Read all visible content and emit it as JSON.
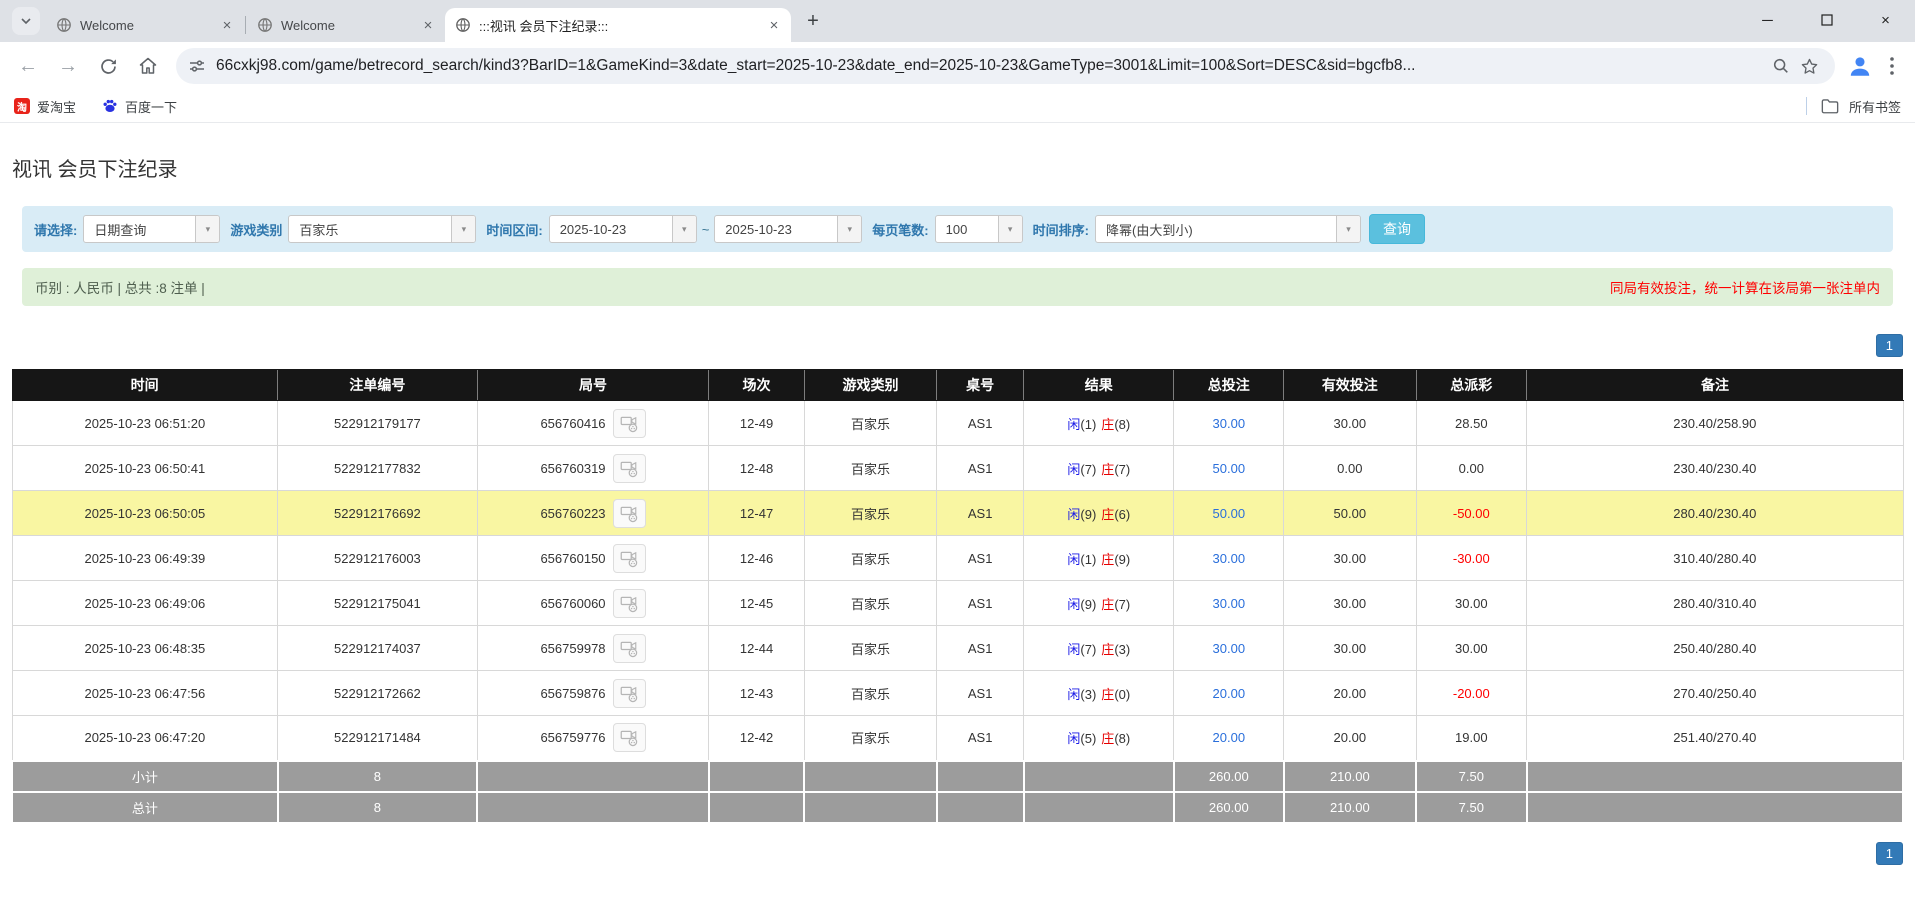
{
  "browser": {
    "tabs": [
      {
        "title": "Welcome"
      },
      {
        "title": "Welcome"
      },
      {
        "title": ":::视讯 会员下注纪录:::"
      }
    ],
    "url": "66cxkj98.com/game/betrecord_search/kind3?BarID=1&GameKind=3&date_start=2025-10-23&date_end=2025-10-23&GameType=3001&Limit=100&Sort=DESC&sid=bgcfb8...",
    "bookmarks": [
      {
        "label": "爱淘宝",
        "icon_text": "淘"
      },
      {
        "label": "百度一下"
      }
    ],
    "all_bookmarks_label": "所有书签"
  },
  "page": {
    "title": "视讯 会员下注纪录",
    "filters": {
      "select_label": "请选择:",
      "select_value": "日期查询",
      "game_type_label": "游戏类别",
      "game_type_value": "百家乐",
      "date_range_label": "时间区间:",
      "date_start": "2025-10-23",
      "date_separator": "~",
      "date_end": "2025-10-23",
      "page_size_label": "每页笔数:",
      "page_size_value": "100",
      "sort_label": "时间排序:",
      "sort_value": "降幂(由大到小)",
      "search_button": "查询"
    },
    "info_bar": {
      "left": "币别 : 人民币 | 总共 :8 注单 |",
      "right": "同局有效投注，统一计算在该局第一张注单内"
    },
    "pagination_label": "1",
    "colors": {
      "highlight_row": "#f9f6a2",
      "negative": "#ff0000",
      "bet_blue": "#2a6fdb",
      "player_blue": "#1a1ae6",
      "banker_red": "#e60000",
      "pagination_blue": "#337ab7",
      "search_button_blue": "#5bc0de"
    },
    "table": {
      "headers": [
        "时间",
        "注单编号",
        "局号",
        "场次",
        "游戏类别",
        "桌号",
        "结果",
        "总投注",
        "有效投注",
        "总派彩",
        "备注"
      ],
      "rows": [
        {
          "time": "2025-10-23 06:51:20",
          "bet_id": "522912179177",
          "round": "656760416",
          "session": "12-49",
          "game": "百家乐",
          "table_no": "AS1",
          "rp": "闲",
          "rpn": "(1)",
          "rb": "庄",
          "rbn": "(8)",
          "total": "30.00",
          "valid": "30.00",
          "payout": "28.50",
          "neg": false,
          "remark": "230.40/258.90",
          "highlight": false
        },
        {
          "time": "2025-10-23 06:50:41",
          "bet_id": "522912177832",
          "round": "656760319",
          "session": "12-48",
          "game": "百家乐",
          "table_no": "AS1",
          "rp": "闲",
          "rpn": "(7)",
          "rb": "庄",
          "rbn": "(7)",
          "total": "50.00",
          "valid": "0.00",
          "payout": "0.00",
          "neg": false,
          "remark": "230.40/230.40",
          "highlight": false
        },
        {
          "time": "2025-10-23 06:50:05",
          "bet_id": "522912176692",
          "round": "656760223",
          "session": "12-47",
          "game": "百家乐",
          "table_no": "AS1",
          "rp": "闲",
          "rpn": "(9)",
          "rb": "庄",
          "rbn": "(6)",
          "total": "50.00",
          "valid": "50.00",
          "payout": "-50.00",
          "neg": true,
          "remark": "280.40/230.40",
          "highlight": true
        },
        {
          "time": "2025-10-23 06:49:39",
          "bet_id": "522912176003",
          "round": "656760150",
          "session": "12-46",
          "game": "百家乐",
          "table_no": "AS1",
          "rp": "闲",
          "rpn": "(1)",
          "rb": "庄",
          "rbn": "(9)",
          "total": "30.00",
          "valid": "30.00",
          "payout": "-30.00",
          "neg": true,
          "remark": "310.40/280.40",
          "highlight": false
        },
        {
          "time": "2025-10-23 06:49:06",
          "bet_id": "522912175041",
          "round": "656760060",
          "session": "12-45",
          "game": "百家乐",
          "table_no": "AS1",
          "rp": "闲",
          "rpn": "(9)",
          "rb": "庄",
          "rbn": "(7)",
          "total": "30.00",
          "valid": "30.00",
          "payout": "30.00",
          "neg": false,
          "remark": "280.40/310.40",
          "highlight": false
        },
        {
          "time": "2025-10-23 06:48:35",
          "bet_id": "522912174037",
          "round": "656759978",
          "session": "12-44",
          "game": "百家乐",
          "table_no": "AS1",
          "rp": "闲",
          "rpn": "(7)",
          "rb": "庄",
          "rbn": "(3)",
          "total": "30.00",
          "valid": "30.00",
          "payout": "30.00",
          "neg": false,
          "remark": "250.40/280.40",
          "highlight": false
        },
        {
          "time": "2025-10-23 06:47:56",
          "bet_id": "522912172662",
          "round": "656759876",
          "session": "12-43",
          "game": "百家乐",
          "table_no": "AS1",
          "rp": "闲",
          "rpn": "(3)",
          "rb": "庄",
          "rbn": "(0)",
          "total": "20.00",
          "valid": "20.00",
          "payout": "-20.00",
          "neg": true,
          "remark": "270.40/250.40",
          "highlight": false
        },
        {
          "time": "2025-10-23 06:47:20",
          "bet_id": "522912171484",
          "round": "656759776",
          "session": "12-42",
          "game": "百家乐",
          "table_no": "AS1",
          "rp": "闲",
          "rpn": "(5)",
          "rb": "庄",
          "rbn": "(8)",
          "total": "20.00",
          "valid": "20.00",
          "payout": "19.00",
          "neg": false,
          "remark": "251.40/270.40",
          "highlight": false
        }
      ],
      "footer": [
        {
          "label": "小计",
          "count": "8",
          "total": "260.00",
          "valid": "210.00",
          "payout": "7.50"
        },
        {
          "label": "总计",
          "count": "8",
          "total": "260.00",
          "valid": "210.00",
          "payout": "7.50"
        }
      ]
    }
  }
}
